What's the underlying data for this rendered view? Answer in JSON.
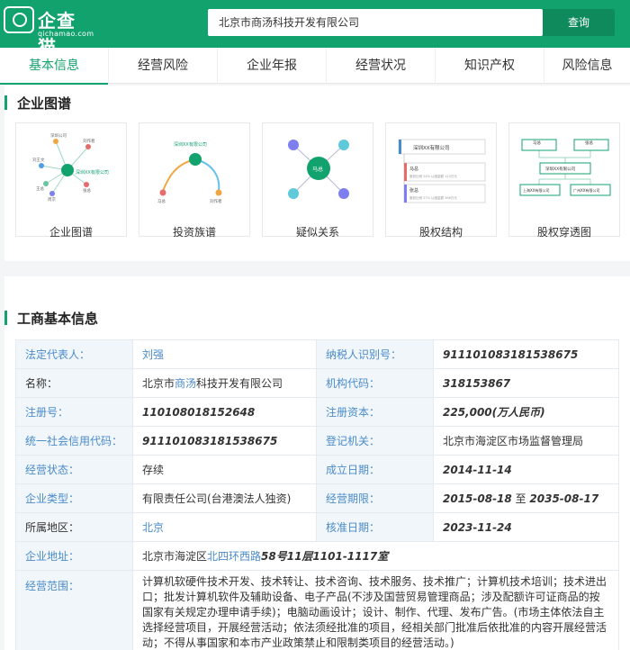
{
  "header": {
    "logo_text": "企查猫",
    "logo_sub": "qichamao.com",
    "search_value": "北京市商汤科技开发有限公司",
    "search_button": "查询"
  },
  "tabs": [
    "基本信息",
    "经营风险",
    "企业年报",
    "经营状况",
    "知识产权",
    "风险信息"
  ],
  "graph_section": {
    "title": "企业图谱",
    "cards": [
      {
        "label": "企业图谱",
        "inner": [
          "深圳XX有限公司"
        ]
      },
      {
        "label": "投资族谱",
        "inner": [
          "深圳XX有限公司"
        ]
      },
      {
        "label": "疑似关系",
        "inner": [
          "马总"
        ]
      },
      {
        "label": "股权结构",
        "inner": [
          "深圳XX有限公司",
          "马总",
          "张总"
        ]
      },
      {
        "label": "股权穿透图",
        "inner": [
          "马总",
          "张总",
          "深圳XX有限公司",
          "上海XX有限公司",
          "广州XX有限公司"
        ]
      }
    ]
  },
  "info_section": {
    "title": "工商基本信息",
    "rows": [
      {
        "l1": "法定代表人：",
        "v1": "刘强",
        "l2": "纳税人识别号：",
        "v2": "911101083181538675"
      },
      {
        "l1": "名称：",
        "v1a": "北京市",
        "v1b": "商汤",
        "v1c": "科技开发有限公司",
        "l2": "机构代码：",
        "v2": "318153867"
      },
      {
        "l1": "注册号：",
        "v1": "110108018152648",
        "l2": "注册资本：",
        "v2": "225,000(万人民币)"
      },
      {
        "l1": "统一社会信用代码：",
        "v1": "911101083181538675",
        "l2": "登记机关：",
        "v2": "北京市海淀区市场监督管理局"
      },
      {
        "l1": "经营状态：",
        "v1": "存续",
        "l2": "成立日期：",
        "v2": "2014-11-14"
      },
      {
        "l1": "企业类型：",
        "v1": "有限责任公司(台港澳法人独资)",
        "l2": "经营期限：",
        "v2a": "2015-08-18",
        "v2b": " 至 ",
        "v2c": "2035-08-17"
      },
      {
        "l1": "所属地区：",
        "v1": "北京",
        "l2": "核准日期：",
        "v2": "2023-11-24"
      }
    ],
    "address_label": "企业地址：",
    "address_a": "北京市海淀区",
    "address_b": "北四环西路",
    "address_c": "58号11层1101-1117室",
    "scope_label": "经营范围：",
    "scope_text": "计算机软硬件技术开发、技术转让、技术咨询、技术服务、技术推广；计算机技术培训；技术进出口；批发计算机软件及辅助设备、电子产品(不涉及国营贸易管理商品；涉及配额许可证商品的按国家有关规定办理申请手续)；电脑动画设计；设计、制作、代理、发布广告。(市场主体依法自主选择经营项目，开展经营活动；依法须经批准的项目，经相关部门批准后依批准的内容开展经营活动；不得从事国家和本市产业政策禁止和限制类项目的经营活动。)"
  },
  "colors": {
    "brand": "#12a26e",
    "label_blue": "#4a8bc9",
    "label_bg": "#f1f6fb"
  }
}
